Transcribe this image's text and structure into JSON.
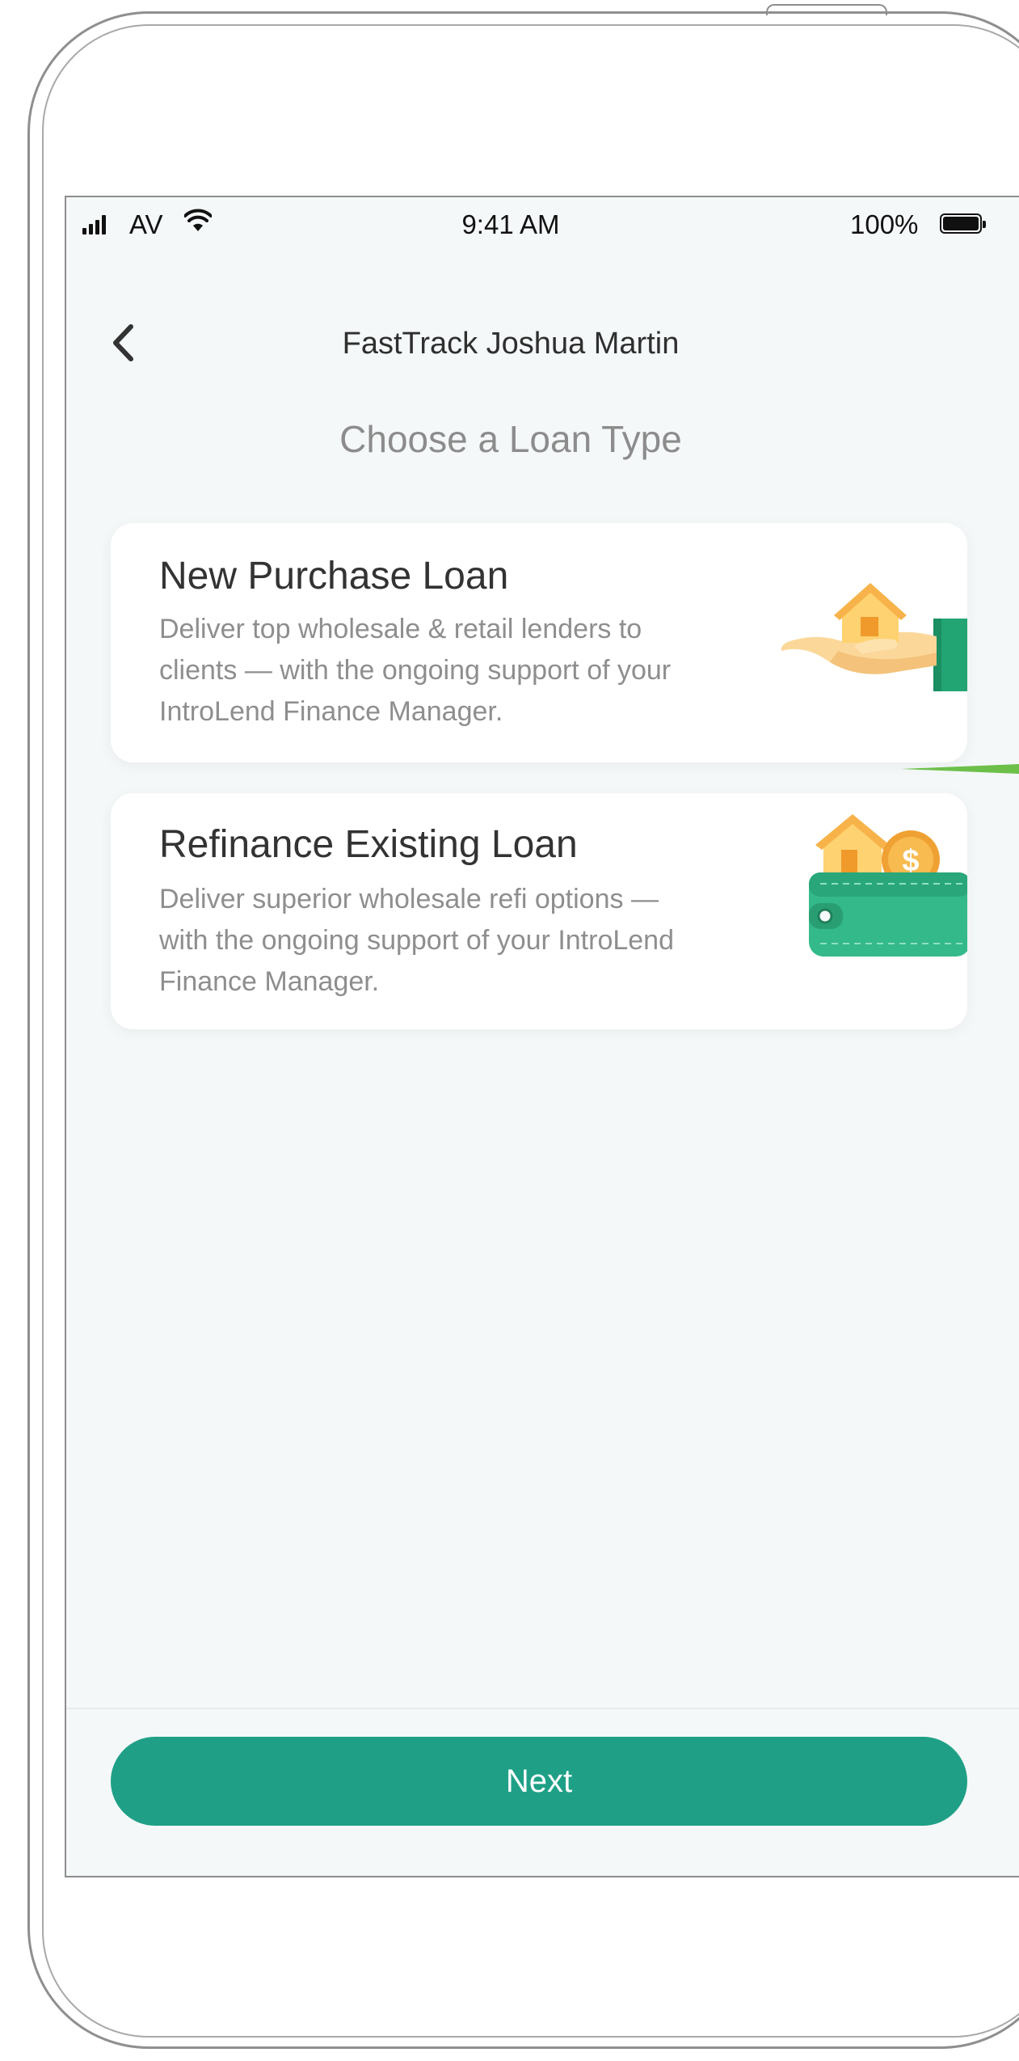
{
  "status_bar": {
    "carrier": "AV",
    "time": "9:41 AM",
    "battery": "100%"
  },
  "nav": {
    "back_icon": "chevron-left-icon",
    "title": "FastTrack Joshua Martin"
  },
  "page": {
    "subtitle": "Choose a Loan Type"
  },
  "cards": [
    {
      "title": "New Purchase Loan",
      "description": "Deliver top wholesale & retail lenders to clients — with the ongoing support of your IntroLend Finance Manager.",
      "icon": "house-in-hand-icon"
    },
    {
      "title": "Refinance Existing Loan",
      "description": "Deliver superior wholesale refi options — with the ongoing support of your IntroLend Finance Manager.",
      "icon": "wallet-house-coin-icon"
    }
  ],
  "footer": {
    "next_label": "Next"
  },
  "colors": {
    "accent": "#1fa086",
    "background": "#f5f8f9",
    "card": "#ffffff",
    "title_text": "#333333",
    "muted_text": "#8e8e8e",
    "pointer": "#6cc04a"
  }
}
